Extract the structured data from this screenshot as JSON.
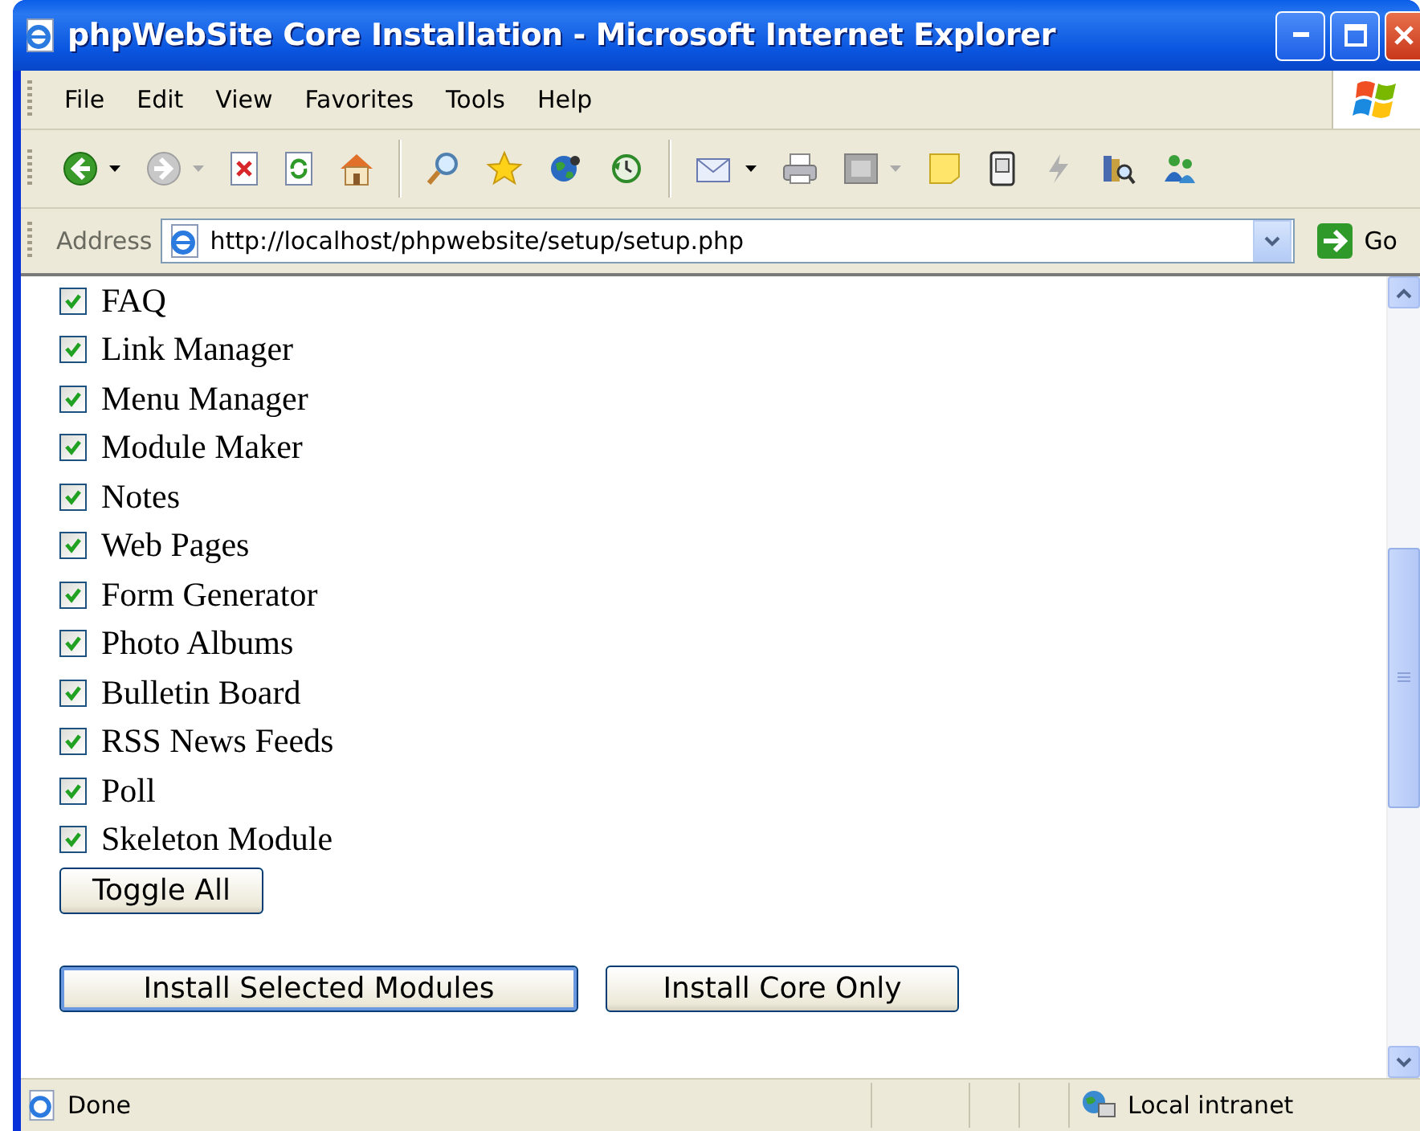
{
  "window": {
    "title": "phpWebSite Core Installation - Microsoft Internet Explorer"
  },
  "menu": [
    "File",
    "Edit",
    "View",
    "Favorites",
    "Tools",
    "Help"
  ],
  "address": {
    "label": "Address",
    "url": "http://localhost/phpwebsite/setup/setup.php",
    "go": "Go"
  },
  "modules": [
    {
      "label": "FAQ",
      "checked": true
    },
    {
      "label": "Link Manager",
      "checked": true
    },
    {
      "label": "Menu Manager",
      "checked": true
    },
    {
      "label": "Module Maker",
      "checked": true
    },
    {
      "label": "Notes",
      "checked": true
    },
    {
      "label": "Web Pages",
      "checked": true
    },
    {
      "label": "Form Generator",
      "checked": true
    },
    {
      "label": "Photo Albums",
      "checked": true
    },
    {
      "label": "Bulletin Board",
      "checked": true
    },
    {
      "label": "RSS News Feeds",
      "checked": true
    },
    {
      "label": "Poll",
      "checked": true
    },
    {
      "label": "Skeleton Module",
      "checked": true
    }
  ],
  "toggle_button": "Toggle All",
  "buttons": [
    {
      "label": "Install Selected Modules",
      "default": true
    },
    {
      "label": "Install Core Only",
      "default": false
    }
  ],
  "status_bar": {
    "text": "Done",
    "zone": "Local intranet"
  }
}
